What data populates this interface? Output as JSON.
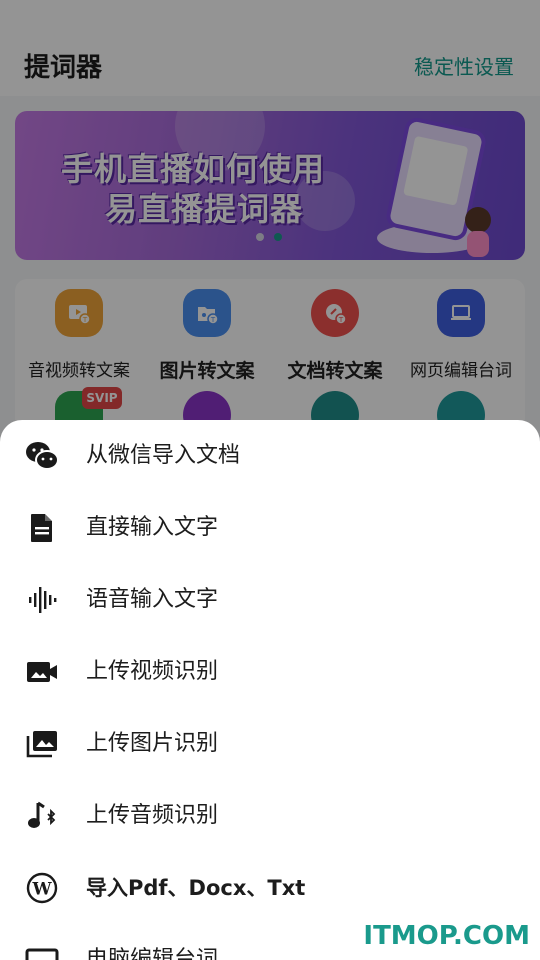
{
  "header": {
    "title": "提词器",
    "settings_link": "稳定性设置"
  },
  "banner": {
    "line1": "手机直播如何使用",
    "line2": "易直播提词器",
    "active_dot": 2,
    "dot_count": 2
  },
  "tools": [
    {
      "label": "音视频转文案",
      "icon": "video-text-icon",
      "color": "#f0a43a"
    },
    {
      "label": "图片转文案",
      "icon": "image-text-icon",
      "color": "#4b8ff0"
    },
    {
      "label": "文档转文案",
      "icon": "doc-text-icon",
      "color": "#f0524f"
    },
    {
      "label": "网页编辑台词",
      "icon": "laptop-icon",
      "color": "#3f5fe0"
    }
  ],
  "tools_row2": [
    {
      "icon": "svip-tool-icon",
      "color": "#2ea652",
      "badge": "SVIP"
    },
    {
      "icon": "trash-icon",
      "color": "#8a35c8"
    },
    {
      "icon": "word-icon",
      "color": "#1f8d8a"
    },
    {
      "icon": "file-edit-icon",
      "color": "#1f9a9b"
    }
  ],
  "sheet": {
    "items": [
      {
        "label": "从微信导入文档",
        "icon": "wechat-icon"
      },
      {
        "label": "直接输入文字",
        "icon": "document-icon"
      },
      {
        "label": "语音输入文字",
        "icon": "voice-wave-icon"
      },
      {
        "label": "上传视频识别",
        "icon": "video-camera-icon"
      },
      {
        "label": "上传图片识别",
        "icon": "photo-library-icon"
      },
      {
        "label": "上传音频识别",
        "icon": "music-note-icon"
      },
      {
        "label": "导入Pdf、Docx、Txt",
        "icon": "wordpress-icon"
      },
      {
        "label": "电脑编辑台词",
        "icon": "computer-icon"
      }
    ]
  },
  "watermark": "ITMOP.COM"
}
